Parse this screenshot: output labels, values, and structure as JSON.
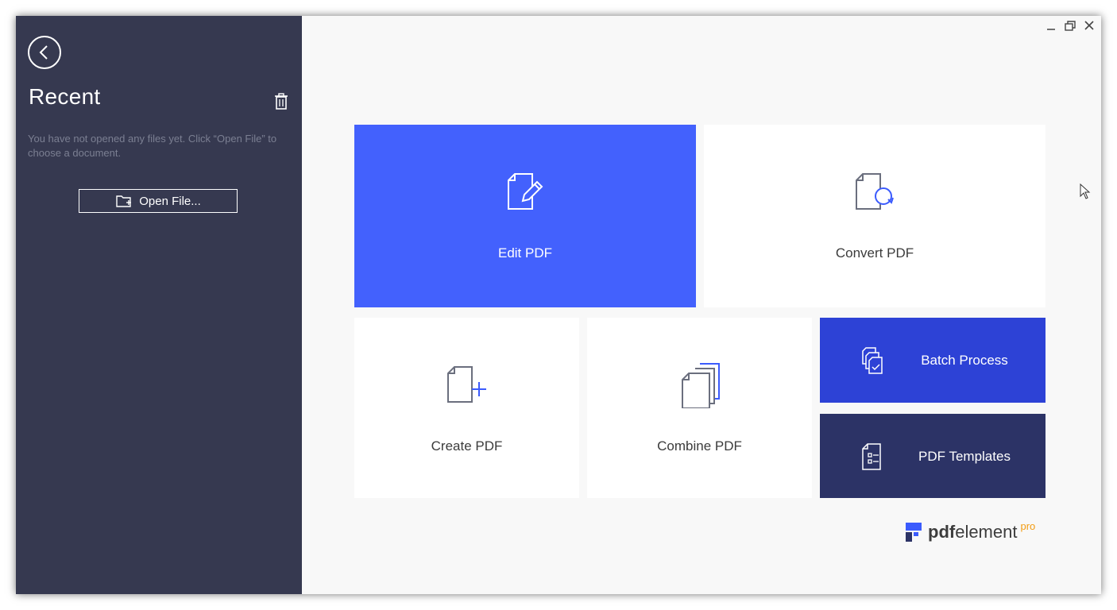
{
  "sidebar": {
    "title": "Recent",
    "empty_message": "You have not opened any files yet. Click “Open File” to choose a document.",
    "open_file_label": "Open File..."
  },
  "tiles": {
    "edit": {
      "label": "Edit PDF",
      "icon": "edit-pdf-icon"
    },
    "convert": {
      "label": "Convert PDF",
      "icon": "convert-pdf-icon"
    },
    "create": {
      "label": "Create PDF",
      "icon": "create-pdf-icon"
    },
    "combine": {
      "label": "Combine PDF",
      "icon": "combine-pdf-icon"
    },
    "batch": {
      "label": "Batch Process",
      "icon": "batch-process-icon"
    },
    "templates": {
      "label": "PDF Templates",
      "icon": "pdf-templates-icon"
    }
  },
  "logo": {
    "bold": "pdf",
    "rest": "element",
    "edition": "pro"
  },
  "colors": {
    "sidebar_bg": "#363950",
    "edit_tile": "#4361fd",
    "batch_tile": "#2d42d6",
    "templates_tile": "#2c3366",
    "logo_accent": "#3b5bfd",
    "pro_accent": "#f39c12"
  }
}
